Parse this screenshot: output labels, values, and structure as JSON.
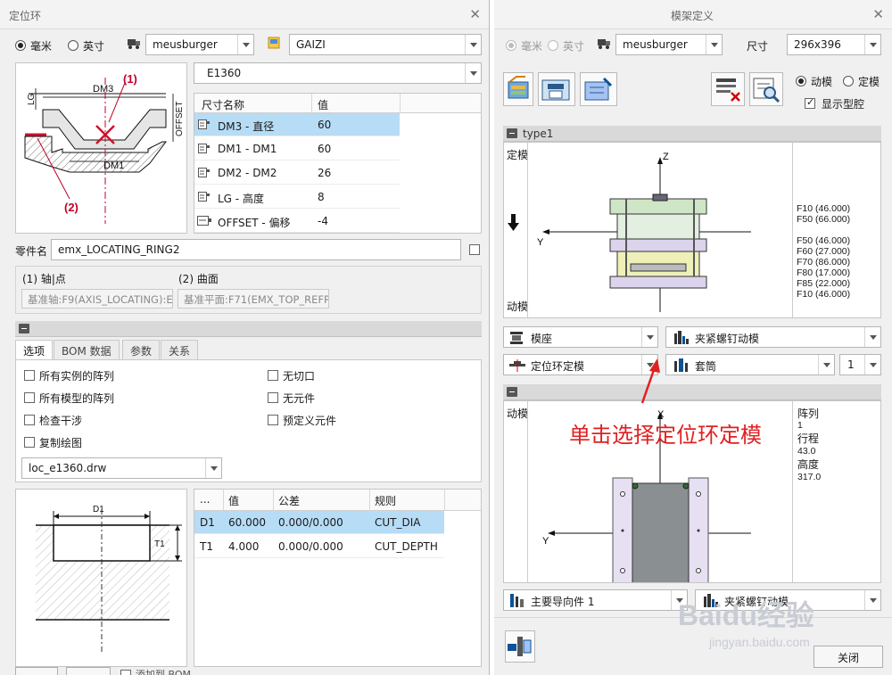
{
  "left": {
    "title": "定位环",
    "unit_mm": "毫米",
    "unit_in": "英寸",
    "supplier": "meusburger",
    "project": "GAIZI",
    "catalog": "E1360",
    "diagram": {
      "dm3": "DM3",
      "dm1": "DM1",
      "lg": "LG",
      "offset": "OFFSET",
      "c1": "(1)",
      "c2": "(2)"
    },
    "dim_table": {
      "headers": [
        "尺寸名称",
        "值"
      ],
      "rows": [
        {
          "name": "DM3 - 直径",
          "value": "60"
        },
        {
          "name": "DM1 - DM1",
          "value": "60"
        },
        {
          "name": "DM2 - DM2",
          "value": "26"
        },
        {
          "name": "LG - 高度",
          "value": "8"
        },
        {
          "name": "OFFSET - 偏移",
          "value": "-4"
        }
      ]
    },
    "part_label": "零件名",
    "part_name": "emx_LOCATING_RING2",
    "ref1_label": "(1) 轴|点",
    "ref2_label": "(2) 曲面",
    "ref1_value": "基准轴:F9(AXIS_LOCATING):E",
    "ref2_value": "基准平面:F71(EMX_TOP_REFP",
    "tabs": [
      "选项",
      "BOM 数据",
      "参数",
      "关系"
    ],
    "options_left": [
      "所有实例的阵列",
      "所有模型的阵列",
      "检查干涉",
      "复制绘图"
    ],
    "options_right": [
      "无切口",
      "无元件",
      "预定义元件"
    ],
    "drawing": "loc_e1360.drw",
    "cut_diagram": {
      "d1": "D1",
      "t1": "T1"
    },
    "cut_table": {
      "headers": [
        "...",
        "值",
        "公差",
        "规则"
      ],
      "rows": [
        {
          "id": "D1",
          "value": "60.000",
          "tol": "0.000/0.000",
          "rule": "CUT_DIA"
        },
        {
          "id": "T1",
          "value": "4.000",
          "tol": "0.000/0.000",
          "rule": "CUT_DEPTH"
        }
      ]
    },
    "bottom_partial": "添加到 BOM"
  },
  "right": {
    "title": "模架定义",
    "unit_mm": "毫米",
    "unit_in": "英寸",
    "supplier": "meusburger",
    "size_label": "尺寸",
    "size": "296x396",
    "mode_moving": "动模",
    "mode_fixed": "定模",
    "show_cavity": "显示型腔",
    "view1_title": "type1",
    "view1": {
      "top_label": "定模",
      "bottom_label": "动模",
      "axis_z": "Z",
      "axis_y": "Y",
      "plates": [
        "F10 (46.000)",
        "F50 (66.000)",
        "F50 (46.000)",
        "F60 (27.000)",
        "F70 (86.000)",
        "F80 (17.000)",
        "F85 (22.000)",
        "F10 (46.000)"
      ]
    },
    "combo_base": "模座",
    "combo_clamp": "夹紧螺钉动模",
    "combo_locate": "定位环定模",
    "combo_sleeve": "套筒",
    "combo_count": "1",
    "view2": {
      "top_label": "动模",
      "axis_x": "X",
      "axis_y": "Y",
      "info": [
        "阵列",
        "1",
        "行程",
        "43.0",
        "高度",
        "317.0"
      ]
    },
    "combo_guide": "主要导向件 1",
    "combo_clamp2": "夹紧螺钉动模",
    "close": "关闭"
  },
  "annotation": "单击选择定位环定模",
  "watermark": {
    "main": "Baidu经验",
    "sub": "jingyan.baidu.com"
  },
  "colors": {
    "selection": "#b7dcf5",
    "annotation": "#e02020",
    "plate_green": "#cfe6c6",
    "plate_purple": "#dcd3ec",
    "plate_yellow": "#eef0b8"
  }
}
